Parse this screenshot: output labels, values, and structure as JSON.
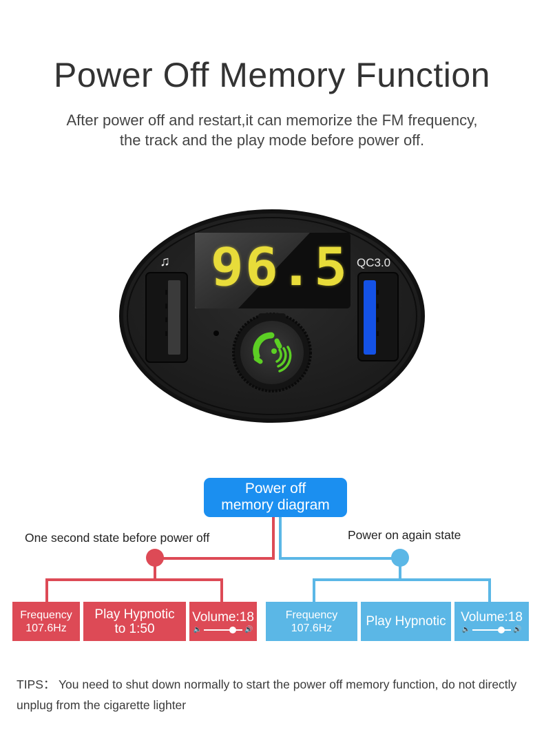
{
  "header": {
    "title": "Power Off Memory Function",
    "subtitle_lines": [
      "After power off and restart,it can memorize the FM frequency,",
      "the track and the play mode before power off."
    ]
  },
  "device": {
    "display_frequency": "96.5",
    "left_port_icon": "music-note-icon",
    "right_port_label": "QC3.0",
    "knob_icon": "bluetooth-call-icon",
    "colors": {
      "display": "#e8dc3a",
      "qc_port": "#1452e6",
      "knob_icon": "#5ccf24",
      "body": "#1e1e1e"
    }
  },
  "diagram": {
    "center": {
      "lines": [
        "Power off",
        "memory diagram"
      ],
      "color": "#1b8ff0"
    },
    "before": {
      "label": "One second state before power off",
      "color": "#dd4a56",
      "boxes": [
        {
          "lines": [
            "Frequency",
            "107.6Hz"
          ]
        },
        {
          "lines": [
            "Play Hypnotic",
            "to 1:50"
          ]
        },
        {
          "label": "Volume:18",
          "volume_fraction": 0.75
        }
      ]
    },
    "after": {
      "label": "Power on again state",
      "color": "#5bb7e6",
      "boxes": [
        {
          "lines": [
            "Frequency",
            "107.6Hz"
          ]
        },
        {
          "lines": [
            "Play Hypnotic"
          ]
        },
        {
          "label": "Volume:18",
          "volume_fraction": 0.75
        }
      ]
    }
  },
  "tips": {
    "text": "TIPS： You need to shut down normally to start the power off memory function, do not directly unplug from the cigarette lighter"
  }
}
